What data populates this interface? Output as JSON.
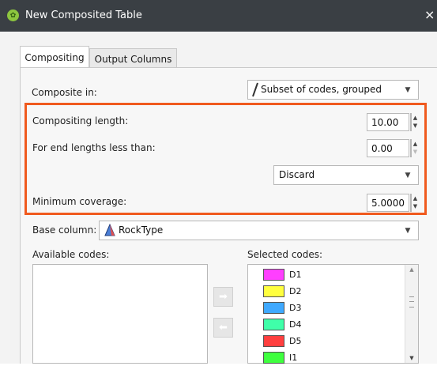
{
  "window": {
    "title": "New Composited Table",
    "close_glyph": "×"
  },
  "tabs": [
    {
      "label": "Compositing",
      "active": true
    },
    {
      "label": "Output Columns",
      "active": false
    }
  ],
  "composite_in": {
    "label": "Composite in:",
    "value": "Subset of codes, grouped"
  },
  "compositing_length": {
    "label": "Compositing length:",
    "value": "10.00"
  },
  "end_lengths": {
    "label": "For end lengths less than:",
    "value": "0.00",
    "action": "Discard"
  },
  "minimum_coverage": {
    "label": "Minimum coverage:",
    "value": "5.0000"
  },
  "base_column": {
    "label": "Base column:",
    "value": "RockType",
    "icon": "rock-type-column-icon"
  },
  "available_codes": {
    "label": "Available codes:",
    "items": []
  },
  "selected_codes": {
    "label": "Selected codes:",
    "items": [
      {
        "label": "D1",
        "color": "#ff3fff"
      },
      {
        "label": "D2",
        "color": "#ffff3f"
      },
      {
        "label": "D3",
        "color": "#3fa9ff"
      },
      {
        "label": "D4",
        "color": "#3fffa9"
      },
      {
        "label": "D5",
        "color": "#ff3f3f"
      },
      {
        "label": "I1",
        "color": "#3fff3f"
      }
    ]
  },
  "colors": {
    "highlight": "#f05a1e",
    "titlebar": "#3a3f44"
  }
}
